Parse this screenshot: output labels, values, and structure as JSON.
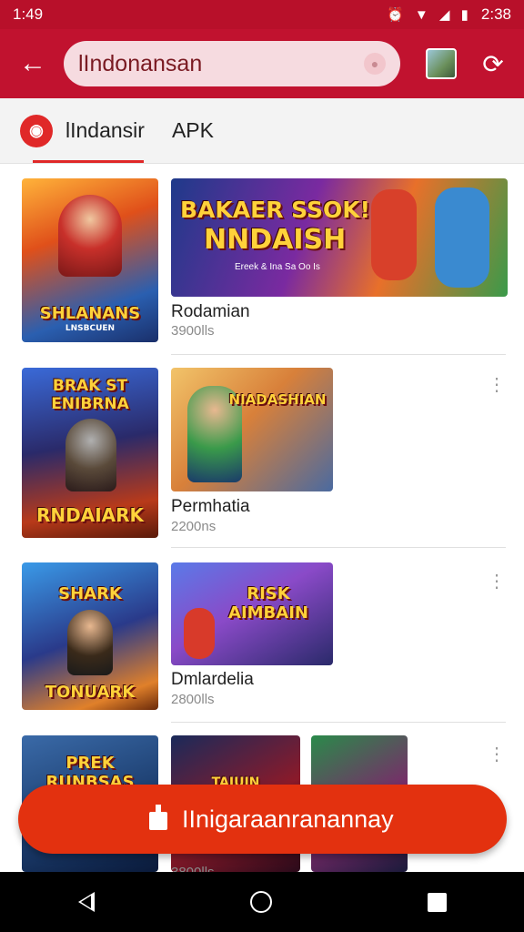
{
  "status_bar": {
    "time_left": "1:49",
    "time_right": "2:38",
    "icons": "⏰ ▼ ◢ ▮"
  },
  "app_bar": {
    "search_value": "lIndonansan",
    "mic_icon": "person-icon"
  },
  "tab": {
    "title": "lIndansir",
    "apk": "APK"
  },
  "rows": [
    {
      "thumb_title": "SHLANANS",
      "thumb_sub": "LNSBCUEN",
      "banner_title": "BAKAER SSOK!",
      "banner_sub": "NNDAISH",
      "banner_caption": "Ereek & Ina Sa Oo Is",
      "title": "Rodamian",
      "meta": "3900lls"
    },
    {
      "thumb_title": "BRAK ST ENIBRNA",
      "thumb_sub": "RNDAIARK",
      "banner_title": "NIADASHIAN",
      "title": "Permhatia",
      "meta": "2200ns"
    },
    {
      "thumb_title": "SHARK",
      "thumb_sub": "TONUARK",
      "banner_title": "RISK AIMBAIN",
      "title": "Dmlardelia",
      "meta": "2800lls"
    },
    {
      "thumb_title": "PREK RUNBSAS",
      "banner_title": "TAIUIN",
      "meta": "3800lls"
    }
  ],
  "fab": {
    "label": "IInigaraanranannay"
  },
  "colors": {
    "brand_red": "#c1122f",
    "fab_orange": "#e3310f"
  }
}
